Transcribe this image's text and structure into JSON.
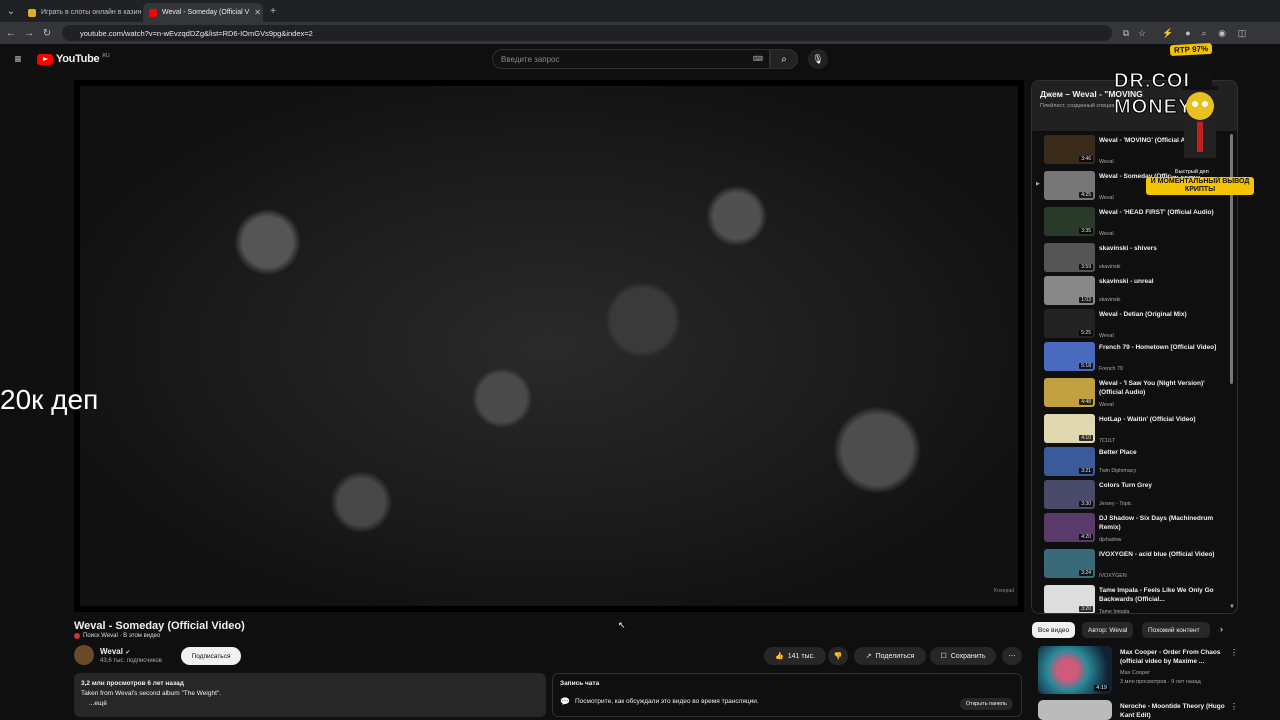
{
  "browser": {
    "tabs": [
      {
        "label": "Играть в слоты онлайн в казин",
        "active": false
      },
      {
        "label": "Weval - Someday (Official V",
        "active": true
      }
    ],
    "url": "youtube.com/watch?v=n-wEvzqdDZg&list=RD6-IOmGVs9pg&index=2"
  },
  "header": {
    "logo": "YouTube",
    "region": "RU",
    "search_placeholder": "Введите запрос"
  },
  "player": {
    "overlay_text": "20к деп",
    "watermark": "Kneepad"
  },
  "video": {
    "title": "Weval - Someday (Official Video)",
    "search_hint": "Поиск Weval · В этом видео",
    "channel": "Weval",
    "subscribers": "43,6 тыс. подписчиков",
    "subscribe_label": "Подписаться",
    "likes": "141 тыс.",
    "share_label": "Поделиться",
    "save_label": "Сохранить",
    "views_date": "3,2 млн просмотров  6 лет назад",
    "description": "Taken from Weval's second album \"The Weight\".",
    "more": "...ещё"
  },
  "chat": {
    "title": "Запись чата",
    "text": "Посмотрите, как обсуждали это видео во время трансляции.",
    "button": "Открыть панель"
  },
  "playlist": {
    "title": "Джем – Weval - \"MOVING",
    "subtitle": "Плейлист, созданный специа",
    "items": [
      {
        "title": "Weval - 'MOVING' (Official Audio)",
        "author": "Weval",
        "duration": "3:46",
        "color": "#3a2a1a"
      },
      {
        "title": "Weval - Someday (Official Video)",
        "author": "Weval",
        "duration": "4:25",
        "color": "#777777",
        "current": true
      },
      {
        "title": "Weval - 'HEAD FIRST' (Official Audio)",
        "author": "Weval",
        "duration": "3:35",
        "color": "#2a3a2a"
      },
      {
        "title": "skavinski - shivers",
        "author": "skavinski",
        "duration": "3:59",
        "color": "#555555"
      },
      {
        "title": "skavinski - unreal",
        "author": "skavinski",
        "duration": "1:03",
        "color": "#888888"
      },
      {
        "title": "Weval - Detian (Original Mix)",
        "author": "Weval",
        "duration": "5:25",
        "color": "#222222"
      },
      {
        "title": "French 79 - Hometown [Official Video]",
        "author": "French 79",
        "duration": "5:18",
        "color": "#4a6ac0"
      },
      {
        "title": "Weval - 'I Saw You (Night Version)' (Official Audio)",
        "author": "Weval",
        "duration": "4:48",
        "color": "#c0a040"
      },
      {
        "title": "HotLap - Waitin' (Official Video)",
        "author": "7CULT",
        "duration": "4:10",
        "color": "#e0d8b0"
      },
      {
        "title": "Better Place",
        "author": "Twin Diplomacy",
        "duration": "3:21",
        "color": "#3a5a9a"
      },
      {
        "title": "Colors Turn Grey",
        "author": "Jersey - Topic",
        "duration": "3:30",
        "color": "#4a4a6a"
      },
      {
        "title": "DJ Shadow - Six Days (Machinedrum Remix)",
        "author": "djshadow",
        "duration": "4:20",
        "color": "#5a3a6a"
      },
      {
        "title": "IVOXYGEN - acid blue (Official Video)",
        "author": "IVOXYGEN",
        "duration": "3:24",
        "color": "#3a6a7a"
      },
      {
        "title": "Tame Impala - Feels Like We Only Go Backwards (Official...",
        "author": "Tame Impala",
        "duration": "3:20",
        "color": "#dddddd"
      }
    ]
  },
  "chips": [
    "Все видео",
    "Автор: Weval",
    "Похожий контент"
  ],
  "recommendations": [
    {
      "title": "Max Cooper - Order From Chaos (official video by Maxime ...",
      "channel": "Max Cooper",
      "meta": "3 млн просмотров · 9 лет назад",
      "duration": "4:19",
      "color": "#2a7a8a"
    },
    {
      "title": "Neroche - Moontide Theory (Hugo Kant Edit)",
      "channel": "",
      "meta": "",
      "duration": "",
      "color": "#cccccc"
    }
  ],
  "ad": {
    "rtp": "RTP 97%",
    "brand": "DR.COIN MONEY",
    "line1": "Быстрый деп",
    "line2": "И МОМЕНТАЛЬНЫЙ ВЫВОД КРИПТЫ"
  }
}
